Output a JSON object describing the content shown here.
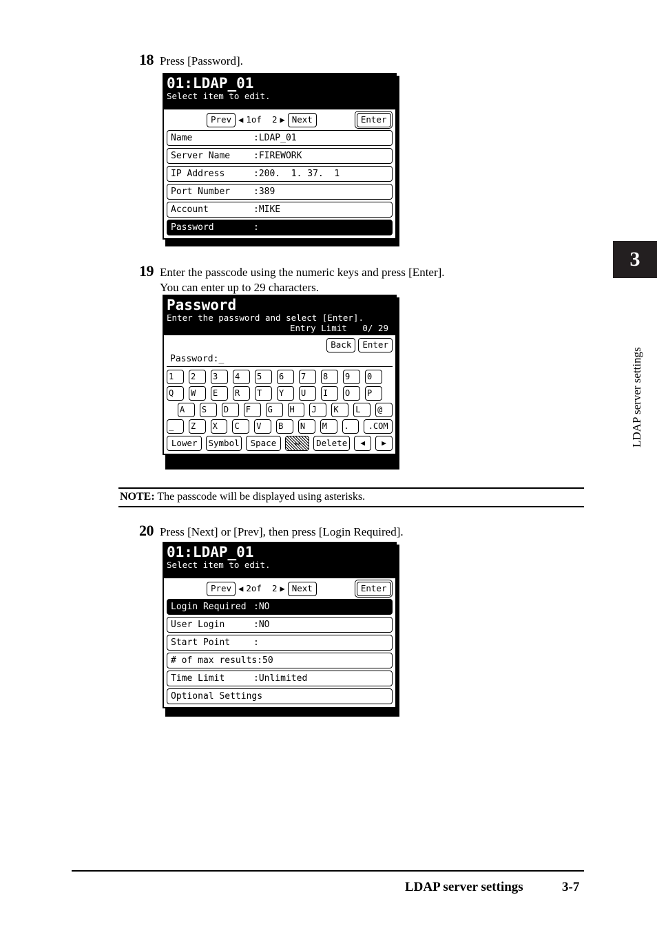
{
  "page": {
    "chapter_number": "3",
    "chapter_label": "LDAP server settings",
    "footer_title": "LDAP server settings",
    "footer_page": "3-7"
  },
  "steps": {
    "s18": {
      "number": "18",
      "text": "Press [Password]."
    },
    "s19": {
      "number": "19",
      "line1": "Enter the passcode using the numeric keys and press [Enter].",
      "line2": "You can enter up to 29 characters."
    },
    "s20": {
      "number": "20",
      "text": "Press [Next] or [Prev], then press [Login Required]."
    }
  },
  "note": {
    "label": "NOTE:",
    "text": "The passcode will be displayed using asterisks."
  },
  "panel_page1": {
    "title": "01:LDAP_01",
    "subtitle": "Select item to edit.",
    "nav": {
      "prev": "Prev",
      "left_arrow": "◀",
      "page": "1of  2",
      "right_arrow": "▶",
      "next": "Next",
      "enter": "Enter"
    },
    "rows": [
      {
        "label": "Name",
        "value": ":LDAP_01",
        "selected": false
      },
      {
        "label": "Server Name",
        "value": ":FIREWORK",
        "selected": false
      },
      {
        "label": "IP Address",
        "value": ":200.  1. 37.  1",
        "selected": false
      },
      {
        "label": "Port Number",
        "value": ":389",
        "selected": false
      },
      {
        "label": "Account",
        "value": ":MIKE",
        "selected": false
      },
      {
        "label": "Password",
        "value": ":",
        "selected": true
      }
    ]
  },
  "panel_password": {
    "title": "Password",
    "subtitle": "Enter the password and select [Enter].",
    "entry_limit": "Entry Limit   0/ 29",
    "buttons": {
      "back": "Back",
      "enter": "Enter"
    },
    "password_field": {
      "label": "Password:",
      "value": "",
      "cursor": "_"
    },
    "keyboard": {
      "row1": [
        "1",
        "2",
        "3",
        "4",
        "5",
        "6",
        "7",
        "8",
        "9",
        "0"
      ],
      "row2": [
        "Q",
        "W",
        "E",
        "R",
        "T",
        "Y",
        "U",
        "I",
        "O",
        "P"
      ],
      "row3": [
        "A",
        "S",
        "D",
        "F",
        "G",
        "H",
        "J",
        "K",
        "L",
        "@"
      ],
      "row4": [
        "_",
        "Z",
        "X",
        "C",
        "V",
        "B",
        "N",
        "M",
        ".",
        ".COM"
      ],
      "functions": {
        "lower": "Lower",
        "symbol": "Symbol",
        "space": "Space",
        "return": "↵",
        "delete": "Delete",
        "arrow_left": "◀",
        "arrow_right": "▶"
      }
    }
  },
  "panel_page2": {
    "title": "01:LDAP_01",
    "subtitle": "Select item to edit.",
    "nav": {
      "prev": "Prev",
      "left_arrow": "◀",
      "page": "2of  2",
      "right_arrow": "▶",
      "next": "Next",
      "enter": "Enter"
    },
    "rows": [
      {
        "label": "Login Required",
        "value": ":NO",
        "selected": true
      },
      {
        "label": "User Login",
        "value": ":NO",
        "selected": false
      },
      {
        "label": "Start Point",
        "value": ":",
        "selected": false
      },
      {
        "label": "# of max results:50",
        "value": "",
        "selected": false
      },
      {
        "label": "Time Limit",
        "value": ":Unlimited",
        "selected": false
      },
      {
        "label": "Optional Settings",
        "value": "",
        "selected": false
      }
    ]
  }
}
